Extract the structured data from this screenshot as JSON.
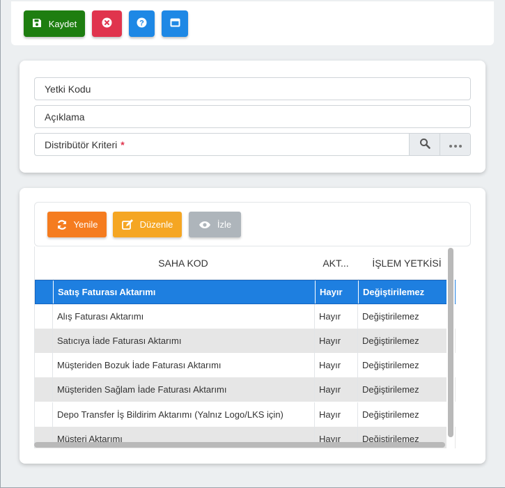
{
  "toolbar": {
    "save_label": "Kaydet",
    "save_icon": "floppy-disk-icon",
    "close_icon": "close-circle-icon",
    "help_icon": "question-circle-icon",
    "window_icon": "window-icon",
    "colors": {
      "save": "#1e7e10",
      "close": "#e0344d",
      "info": "#1e88e5"
    }
  },
  "form": {
    "yetki_kodu_label": "Yetki Kodu",
    "aciklama_label": "Açıklama",
    "distributor_label": "Distribütör Kriteri",
    "required_mark": "*",
    "search_icon": "magnifier-icon",
    "more_icon": "ellipsis-icon"
  },
  "grid_toolbar": {
    "yenile_label": "Yenile",
    "duzenle_label": "Düzenle",
    "izle_label": "İzle",
    "colors": {
      "yenile": "#f57c1f",
      "duzenle": "#f5a623",
      "izle": "#aeb5bb"
    }
  },
  "table": {
    "columns": [
      "SAHA KOD",
      "AKT...",
      "İŞLEM YETKİSİ"
    ],
    "rows": [
      {
        "saha": "Satış Faturası Aktarımı",
        "akt": "Hayır",
        "islem": "Değiştirilemez"
      },
      {
        "saha": "Alış Faturası Aktarımı",
        "akt": "Hayır",
        "islem": "Değiştirilemez"
      },
      {
        "saha": "Satıcıya İade Faturası Aktarımı",
        "akt": "Hayır",
        "islem": "Değiştirilemez"
      },
      {
        "saha": "Müşteriden Bozuk İade Faturası Aktarımı",
        "akt": "Hayır",
        "islem": "Değiştirilemez"
      },
      {
        "saha": "Müşteriden Sağlam İade Faturası Aktarımı",
        "akt": "Hayır",
        "islem": "Değiştirilemez"
      },
      {
        "saha": "Depo Transfer İş Bildirim Aktarımı (Yalnız Logo/LKS için)",
        "akt": "Hayır",
        "islem": "Değiştirilemez"
      },
      {
        "saha": "Müşteri Aktarımı",
        "akt": "Hayır",
        "islem": "Değiştirilemez"
      }
    ],
    "selected_index": 0,
    "selection_color": "#1e7fe0"
  }
}
